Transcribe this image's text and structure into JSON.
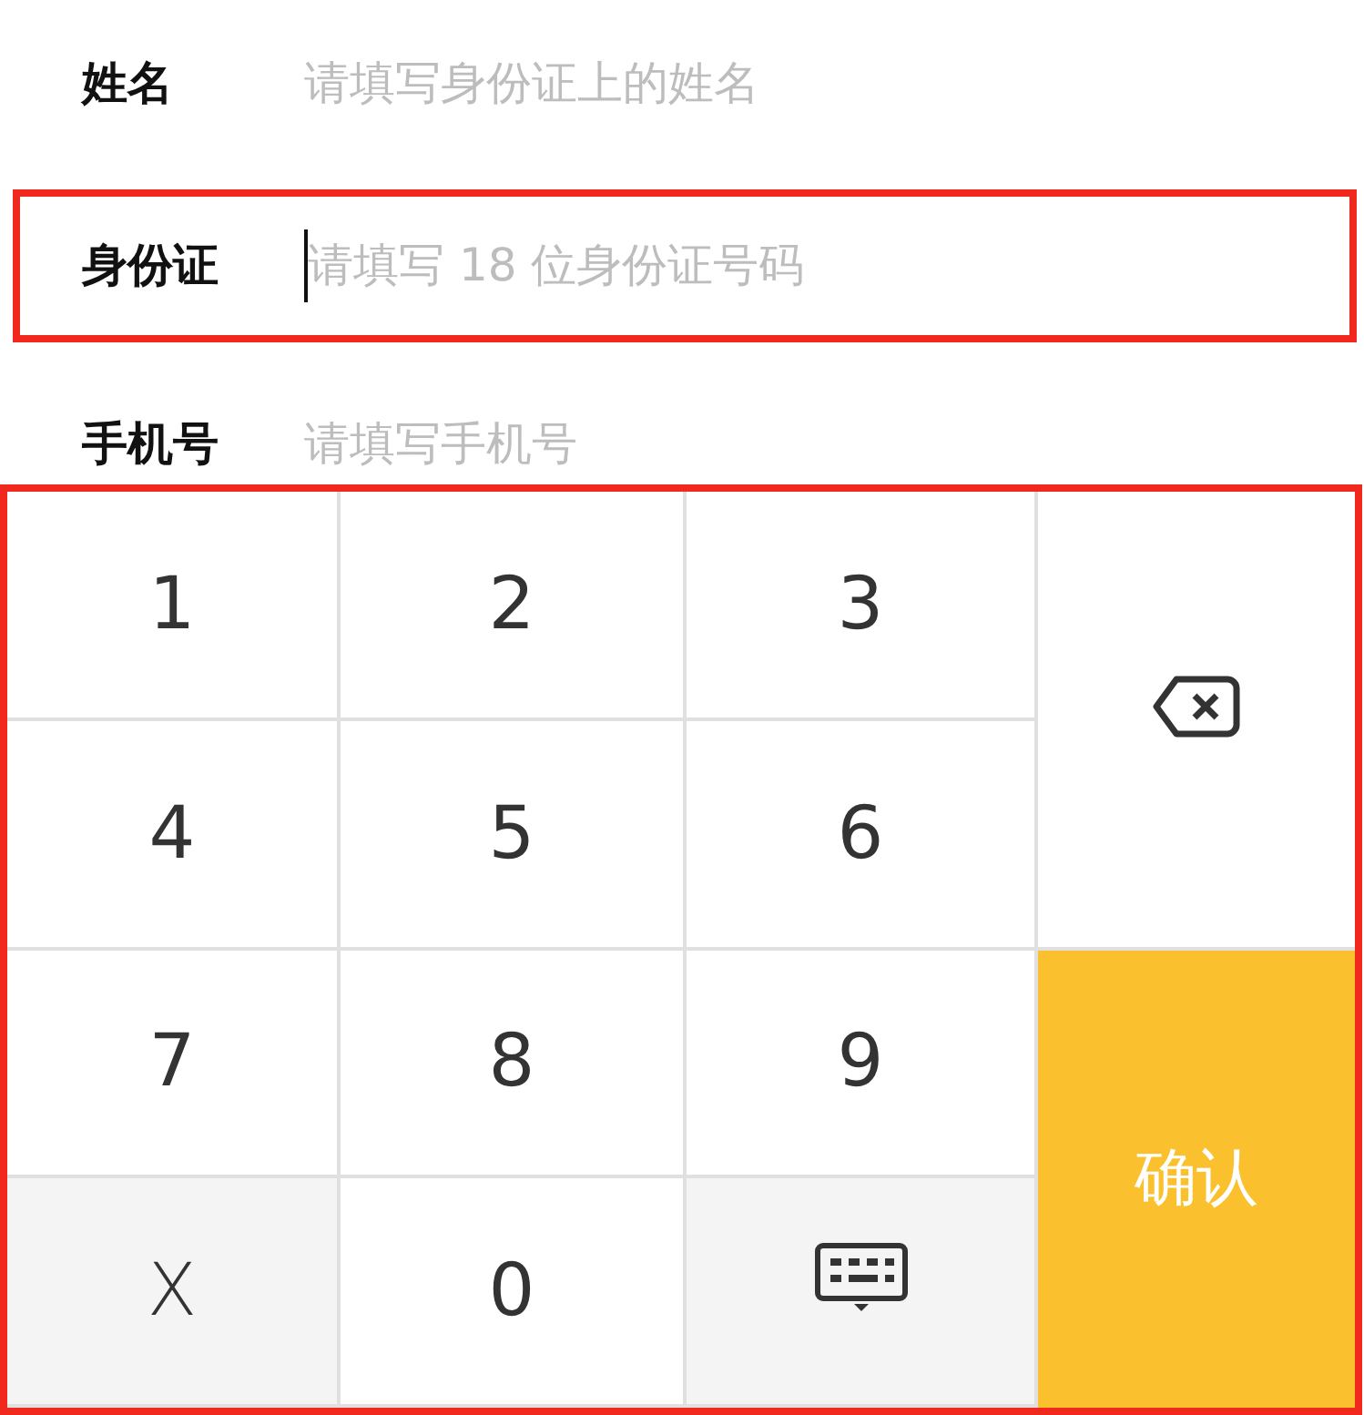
{
  "fields": [
    {
      "label": "姓名",
      "placeholder": "请填写身份证上的姓名",
      "focused": false,
      "highlighted": false
    },
    {
      "label": "身份证",
      "placeholder": "请填写 18 位身份证号码",
      "focused": true,
      "highlighted": true
    },
    {
      "label": "手机号",
      "placeholder": "请填写手机号",
      "focused": false,
      "highlighted": false
    }
  ],
  "keypad": {
    "highlighted": true,
    "keys": [
      {
        "kind": "digit",
        "label": "1"
      },
      {
        "kind": "digit",
        "label": "2"
      },
      {
        "kind": "digit",
        "label": "3"
      },
      {
        "kind": "delete"
      },
      {
        "kind": "digit",
        "label": "4"
      },
      {
        "kind": "digit",
        "label": "5"
      },
      {
        "kind": "digit",
        "label": "6"
      },
      {
        "kind": "digit",
        "label": "7"
      },
      {
        "kind": "digit",
        "label": "8"
      },
      {
        "kind": "digit",
        "label": "9"
      },
      {
        "kind": "confirm",
        "label": "确认"
      },
      {
        "kind": "letter",
        "label": "X"
      },
      {
        "kind": "digit",
        "label": "0"
      },
      {
        "kind": "hide"
      }
    ]
  }
}
